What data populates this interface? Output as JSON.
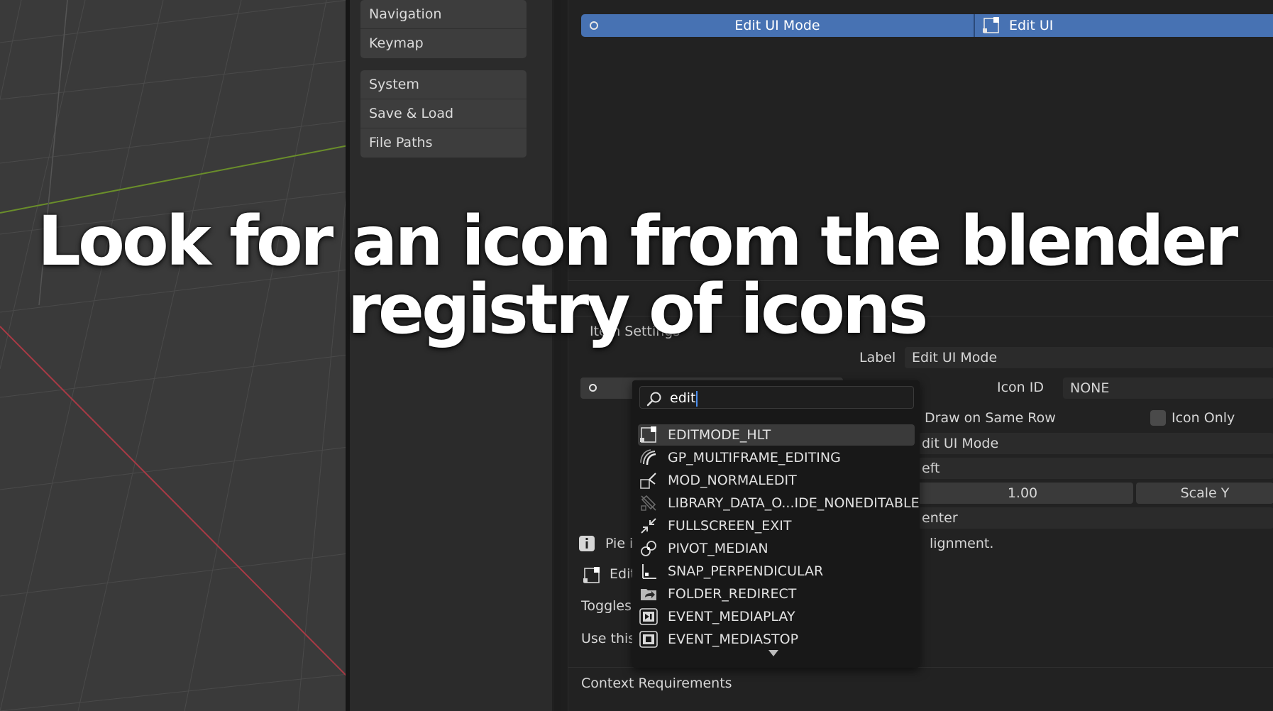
{
  "overlay": {
    "line1": "Look for an icon from the blender",
    "line2": "registry of icons"
  },
  "nav": {
    "group1": [
      "Navigation",
      "Keymap"
    ],
    "group2": [
      "System",
      "Save & Load",
      "File Paths"
    ]
  },
  "pie_header": {
    "seg1": "Edit UI Mode",
    "seg2": "Edit UI"
  },
  "item_settings": {
    "section": "Item Settings",
    "label_label": "Label",
    "label_value": "Edit UI Mode",
    "icon_id_label": "Icon ID",
    "icon_id_value": "NONE",
    "draw_same_row": "Draw on Same Row",
    "icon_only": "Icon Only",
    "partial_edit_mode": "dit UI Mode",
    "partial_left": "eft",
    "scale_value": "1.00",
    "scale_y": "Scale Y",
    "partial_center": "enter",
    "partial_alignment": "lignment.",
    "pie_ite": "Pie ite",
    "edit_short": "Edit",
    "toggles": "Toggles S",
    "use_this": "Use this i",
    "context": "Context Requirements"
  },
  "search": {
    "query": "edit"
  },
  "dropdown": {
    "items": [
      {
        "label": "EDITMODE_HLT",
        "icon": "editmode-icon"
      },
      {
        "label": "GP_MULTIFRAME_EDITING",
        "icon": "multiframe-icon"
      },
      {
        "label": "MOD_NORMALEDIT",
        "icon": "normaledit-icon"
      },
      {
        "label": "LIBRARY_DATA_O...IDE_NONEDITABLE",
        "icon": "library-noneditable-icon"
      },
      {
        "label": "FULLSCREEN_EXIT",
        "icon": "fullscreen-exit-icon"
      },
      {
        "label": "PIVOT_MEDIAN",
        "icon": "pivot-median-icon"
      },
      {
        "label": "SNAP_PERPENDICULAR",
        "icon": "snap-perpendicular-icon"
      },
      {
        "label": "FOLDER_REDIRECT",
        "icon": "folder-redirect-icon"
      },
      {
        "label": "EVENT_MEDIAPLAY",
        "icon": "media-play-icon"
      },
      {
        "label": "EVENT_MEDIASTOP",
        "icon": "media-stop-icon"
      }
    ]
  },
  "colors": {
    "accent": "#4772b3",
    "grid_x": "#a83a45",
    "grid_y": "#6a8e2a"
  }
}
